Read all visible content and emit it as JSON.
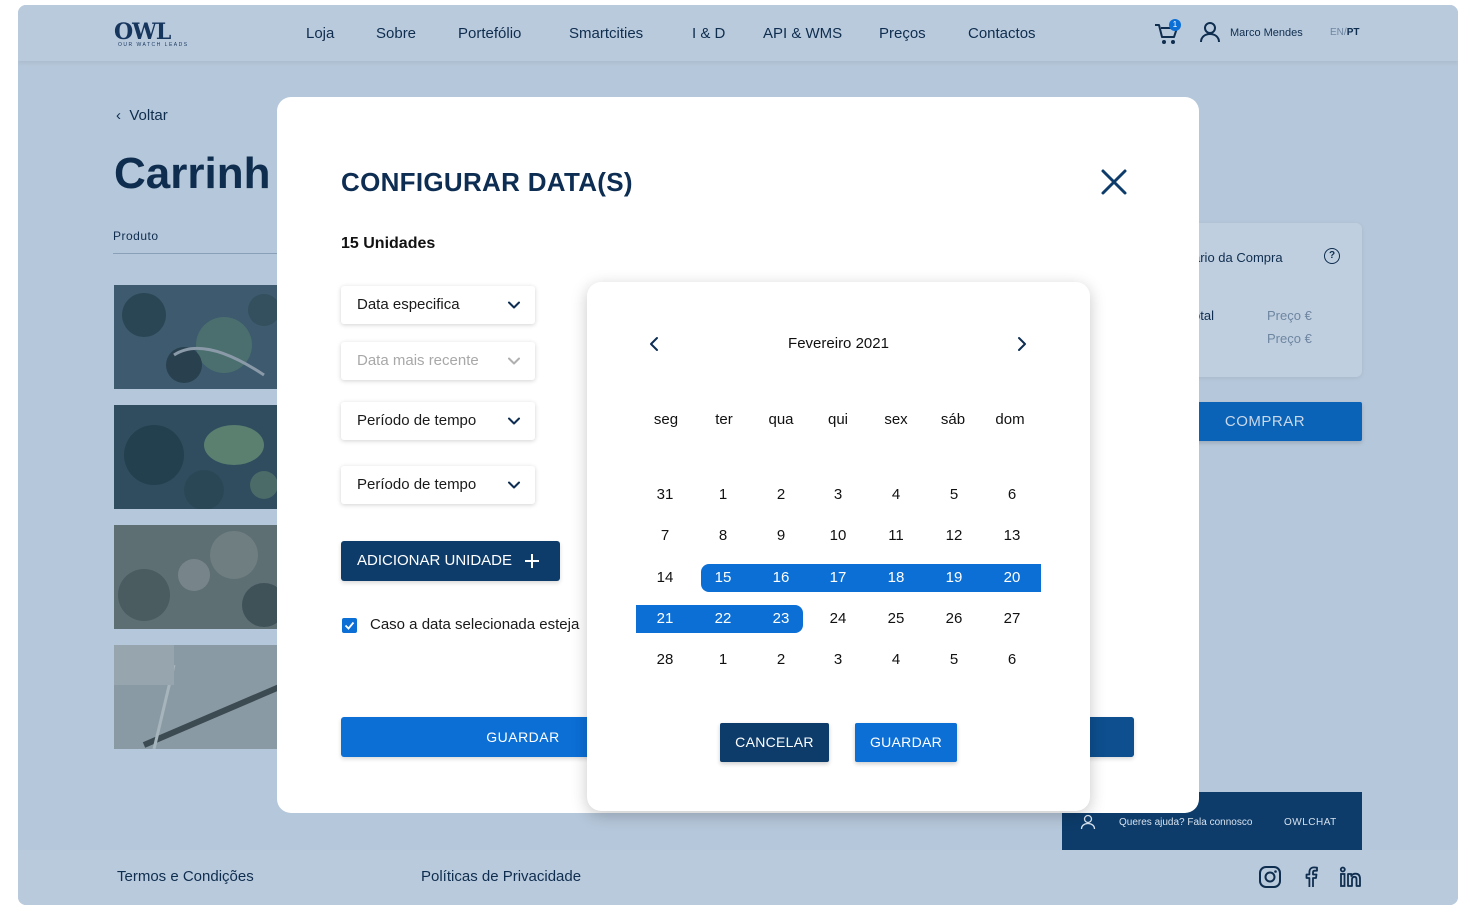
{
  "header": {
    "logo_text": "OWL",
    "logo_tagline": "OUR WATCH LEADS",
    "nav": [
      "Loja",
      "Sobre",
      "Portefólio",
      "Smartcities",
      "I & D",
      "API & WMS",
      "Preços",
      "Contactos"
    ],
    "cart_count": "1",
    "user_name": "Marco Mendes",
    "lang_en": "EN",
    "lang_sep": "/",
    "lang_pt": "PT"
  },
  "page": {
    "back_label": "Voltar",
    "title": "Carrinh",
    "column_product": "Produto",
    "summary_title": "ário da Compra",
    "summary_total": "otal",
    "summary_price_1": "Preço €",
    "summary_price_2": "Preço €",
    "buy_label": "COMPRAR"
  },
  "chat": {
    "text": "Queres ajuda? Fala connosco",
    "brand": "OWLCHAT"
  },
  "footer": {
    "terms": "Termos e Condições",
    "privacy": "Políticas de Privacidade"
  },
  "modal": {
    "title": "CONFIGURAR DATA(S)",
    "units": "15 Unidades",
    "selects": [
      {
        "label": "Data especifica",
        "disabled": false
      },
      {
        "label": "Data mais recente",
        "disabled": true
      },
      {
        "label": "Período de tempo",
        "disabled": false
      },
      {
        "label": "Período de tempo",
        "disabled": false
      }
    ],
    "add_unit_label": "ADICIONAR UNIDADE",
    "checkbox_label": "Caso a data selecionada esteja",
    "checkbox_checked": true,
    "save_label": "GUARDAR"
  },
  "calendar": {
    "month_label": "Fevereiro 2021",
    "weekdays": [
      "seg",
      "ter",
      "qua",
      "qui",
      "sex",
      "sáb",
      "dom"
    ],
    "weeks": [
      [
        "31",
        "1",
        "2",
        "3",
        "4",
        "5",
        "6"
      ],
      [
        "7",
        "8",
        "9",
        "10",
        "11",
        "12",
        "13"
      ],
      [
        "14",
        "15",
        "16",
        "17",
        "18",
        "19",
        "20"
      ],
      [
        "21",
        "22",
        "23",
        "24",
        "25",
        "26",
        "27"
      ],
      [
        "28",
        "1",
        "2",
        "3",
        "4",
        "5",
        "6"
      ]
    ],
    "selected_range": [
      "15",
      "23"
    ],
    "cancel_label": "CANCELAR",
    "save_label": "GUARDAR"
  },
  "colors": {
    "primary_blue": "#0b6fd6",
    "dark_navy": "#0d3c6b",
    "overlay_bg": "#b5c7da"
  }
}
